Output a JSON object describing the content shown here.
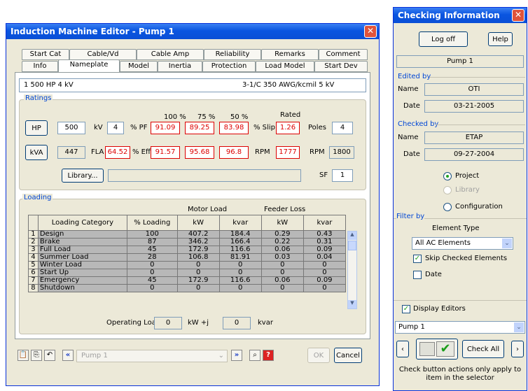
{
  "editor": {
    "title": "Induction Machine Editor - Pump 1",
    "tabs_row1": [
      "Start Cat",
      "Cable/Vd",
      "Cable Amp",
      "Reliability",
      "Remarks",
      "Comment"
    ],
    "tabs_row2": [
      "Info",
      "Nameplate",
      "Model",
      "Inertia",
      "Protection",
      "Load Model",
      "Start Dev"
    ],
    "active_tab": "Nameplate",
    "summary_left": "1  500 HP  4 kV",
    "summary_right": "3-1/C  350 AWG/kcmil  5 kV",
    "ratings": {
      "title": "Ratings",
      "hp_btn": "HP",
      "hp_val": "500",
      "kv_lbl": "kV",
      "kv_val": "4",
      "kva_btn": "kVA",
      "kva_val": "447",
      "fla_lbl": "FLA",
      "fla_val": "64.52",
      "col100": "100 %",
      "col75": "75 %",
      "col50": "50 %",
      "pf_lbl": "% PF",
      "pf": [
        "91.09",
        "89.25",
        "83.98"
      ],
      "eff_lbl": "% Eff",
      "eff": [
        "91.57",
        "95.68",
        "96.8"
      ],
      "rated_lbl": "Rated",
      "slip_lbl": "% Slip",
      "slip_val": "1.26",
      "poles_lbl": "Poles",
      "poles_val": "4",
      "rpm_lbl": "RPM",
      "rpm_val": "1777",
      "rpm2_lbl": "RPM",
      "rpm2_val": "1800",
      "library_btn": "Library...",
      "sf_lbl": "SF",
      "sf_val": "1"
    },
    "loading": {
      "title": "Loading",
      "motor_load": "Motor Load",
      "feeder_loss": "Feeder Loss",
      "headers": [
        "Loading Category",
        "% Loading",
        "kW",
        "kvar",
        "kW",
        "kvar"
      ],
      "rows": [
        [
          "1",
          "Design",
          "100",
          "407.2",
          "184.4",
          "0.29",
          "0.43"
        ],
        [
          "2",
          "Brake",
          "87",
          "346.2",
          "166.4",
          "0.22",
          "0.31"
        ],
        [
          "3",
          "Full Load",
          "45",
          "172.9",
          "116.6",
          "0.06",
          "0.09"
        ],
        [
          "4",
          "Summer Load",
          "28",
          "106.8",
          "81.91",
          "0.03",
          "0.04"
        ],
        [
          "5",
          "Winter Load",
          "0",
          "0",
          "0",
          "0",
          "0"
        ],
        [
          "6",
          "Start Up",
          "0",
          "0",
          "0",
          "0",
          "0"
        ],
        [
          "7",
          "Emergency",
          "45",
          "172.9",
          "116.6",
          "0.06",
          "0.09"
        ],
        [
          "8",
          "Shutdown",
          "0",
          "0",
          "0",
          "0",
          "0"
        ]
      ],
      "op_lbl": "Operating Load:",
      "op_kw": "0",
      "kw_lbl": "kW  +j",
      "op_kvar": "0",
      "kvar_lbl": "kvar"
    },
    "bottom": {
      "selector": "Pump 1",
      "ok": "OK",
      "cancel": "Cancel"
    }
  },
  "checker": {
    "title": "Checking Information",
    "logoff": "Log off",
    "help": "Help",
    "element": "Pump 1",
    "edited_by": "Edited by",
    "name_lbl": "Name",
    "edited_name": "OTI",
    "date_lbl": "Date",
    "edited_date": "03-21-2005",
    "checked_by": "Checked by",
    "checked_name": "ETAP",
    "checked_date": "09-27-2004",
    "opt_project": "Project",
    "opt_library": "Library",
    "opt_config": "Configuration",
    "filter_by": "Filter by",
    "element_type": "Element Type",
    "element_type_val": "All AC Elements",
    "skip_checked": "Skip Checked Elements",
    "date_opt": "Date",
    "display_editors": "Display Editors",
    "selector_val": "Pump 1",
    "check_all": "Check All",
    "note": "Check button actions only apply to item in the selector"
  }
}
